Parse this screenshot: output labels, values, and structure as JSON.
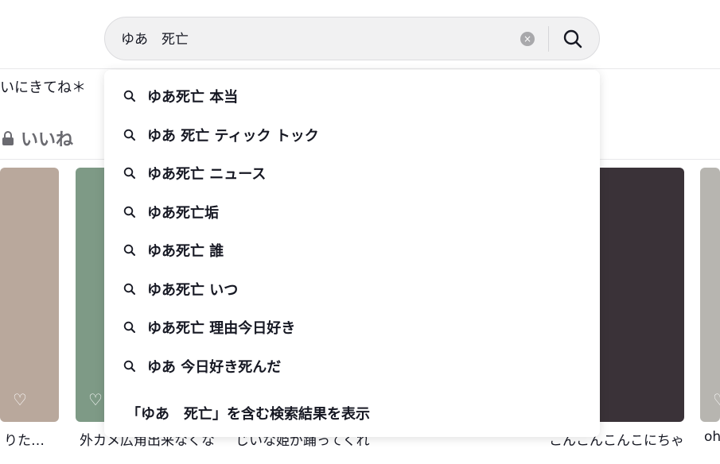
{
  "search": {
    "value": "ゆあ　死亡",
    "clear_icon": "×"
  },
  "profile": {
    "bio_fragment": "いにきてね＊",
    "liked_tab": "いいね"
  },
  "suggestions": [
    "ゆあ死亡 本当",
    "ゆあ 死亡 ティック トック",
    "ゆあ死亡 ニュース",
    "ゆあ死亡垢",
    "ゆあ死亡 誰",
    "ゆあ死亡 いつ",
    "ゆあ死亡 理由今日好き",
    "ゆあ 今日好き死んだ"
  ],
  "show_all": "「ゆあ　死亡」を含む検索結果を表示",
  "videos": [
    {
      "caption": "りた…",
      "color": "#b9a89c"
    },
    {
      "caption": "外カメ広角出来なくな…",
      "color": "#7e9a86"
    },
    {
      "caption": "じいな姫が踊ってくれ…",
      "color": "#c9c0b8"
    },
    {
      "caption": "",
      "color": "#a89888"
    },
    {
      "caption": "こんこんこんこにちゃ…",
      "color": "#3a3238"
    },
    {
      "caption": "oh",
      "color": "#b7b5b0"
    }
  ]
}
